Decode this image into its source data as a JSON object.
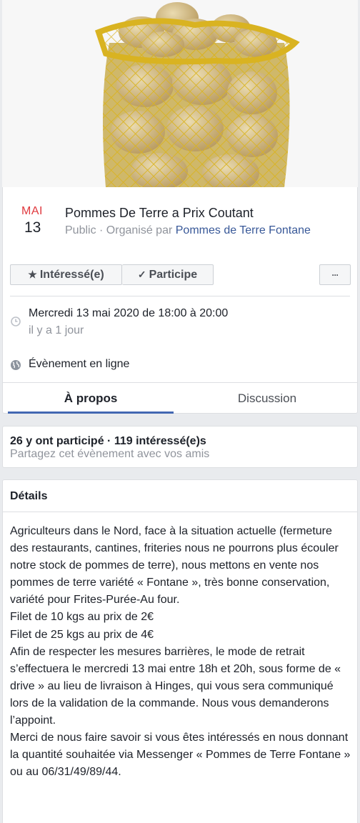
{
  "event": {
    "month": "MAI",
    "day": "13",
    "title": "Pommes De Terre a Prix Coutant",
    "privacy_prefix": "Public · Organisé par",
    "organizer": "Pommes de Terre Fontane"
  },
  "actions": {
    "interested_label": "Intéressé(e)",
    "going_label": "Participe",
    "more_label": "···"
  },
  "info": {
    "datetime": "Mercredi 13 mai 2020 de 18:00 à 20:00",
    "relative": "il y a 1 jour",
    "location": "Évènement en ligne"
  },
  "tabs": [
    {
      "label": "À propos"
    },
    {
      "label": "Discussion"
    }
  ],
  "stats": {
    "summary": "26 y ont participé · 119 intéressé(e)s",
    "share": "Partagez cet évènement avec vos amis"
  },
  "details": {
    "title": "Détails",
    "lines": [
      "Agriculteurs dans le Nord, face à la situation actuelle (fermeture des restaurants, cantines, friteries nous ne pourrons plus écouler notre stock de pommes de terre), nous mettons en vente nos pommes de terre variété « Fontane », très bonne conservation, variété pour Frites-Purée-Au four.",
      "Filet de 10 kgs au prix de 2€",
      "Filet de 25 kgs au prix de 4€",
      "Afin de respecter les mesures barrières, le mode de retrait s’effectuera le mercredi 13 mai entre 18h et 20h, sous forme de  « drive » au lieu de livraison à Hinges, qui vous sera communiqué lors de la validation de la commande. Nous vous demanderons l’appoint.",
      "Merci de nous faire savoir si vous êtes intéressés en nous donnant la quantité souhaitée via Messenger « Pommes de Terre Fontane » ou au 06/31/49/89/44."
    ]
  },
  "icons": {
    "clock": "clock-icon",
    "globe": "globe-icon",
    "star": "star-icon",
    "check": "check-icon"
  },
  "colors": {
    "date_month": "#e0393e",
    "link": "#385898",
    "tab_indicator": "#4267b2",
    "secondary_text": "#90949c"
  }
}
